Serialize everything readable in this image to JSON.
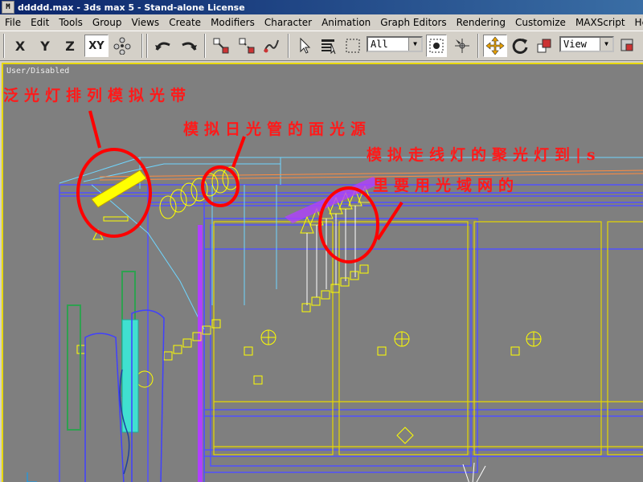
{
  "window": {
    "title": "ddddd.max - 3ds max 5 - Stand-alone License",
    "icon": "3ds-max-app-icon"
  },
  "menu": [
    "File",
    "Edit",
    "Tools",
    "Group",
    "Views",
    "Create",
    "Modifiers",
    "Character",
    "Animation",
    "Graph Editors",
    "Rendering",
    "Customize",
    "MAXScript",
    "Help"
  ],
  "toolbar": {
    "axis_x": "X",
    "axis_y": "Y",
    "axis_z": "Z",
    "axis_xy": "XY",
    "selection_filter": "All",
    "reference_coord": "View",
    "icons": [
      "axis-constraints-icon",
      "undo-icon",
      "redo-icon",
      "select-and-link-icon",
      "unlink-icon",
      "bind-to-space-warp-icon",
      "select-object-icon",
      "select-by-name-icon",
      "rectangular-selection-icon",
      "window-crossing-icon",
      "select-and-manipulate-icon",
      "select-and-move-icon",
      "select-and-rotate-icon",
      "select-and-scale-icon",
      "use-pivot-icon"
    ]
  },
  "viewport": {
    "label": "User/Disabled"
  },
  "annotations": {
    "a1": "泛光灯排列模拟光带",
    "a2": "模拟日光管的面光源",
    "a3": "模拟走线灯的聚光灯到|s",
    "a4": "里要用光域网的"
  },
  "colors": {
    "viewport_bg": "#7f7f7f",
    "annotation": "#ff1a1a",
    "light_gizmo": "#ffff00",
    "active_border": "#e8d800",
    "wireframe_blue": "#4040ff"
  }
}
